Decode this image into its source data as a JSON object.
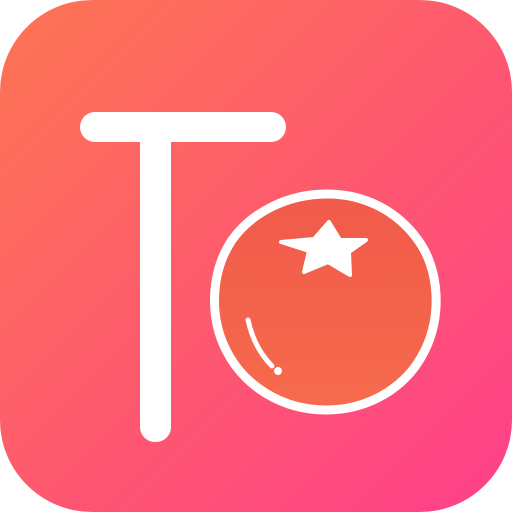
{
  "icon": {
    "name": "app-icon",
    "letter": "T",
    "fruit": "tomato-icon"
  },
  "colors": {
    "background_top_left": "#fd7552",
    "background_bottom_right": "#fe3f8a",
    "glyph": "#ffffff",
    "tomato_top": "#f15a4a",
    "tomato_bottom": "#f66b4d",
    "tomato_outline": "#ffffff"
  }
}
